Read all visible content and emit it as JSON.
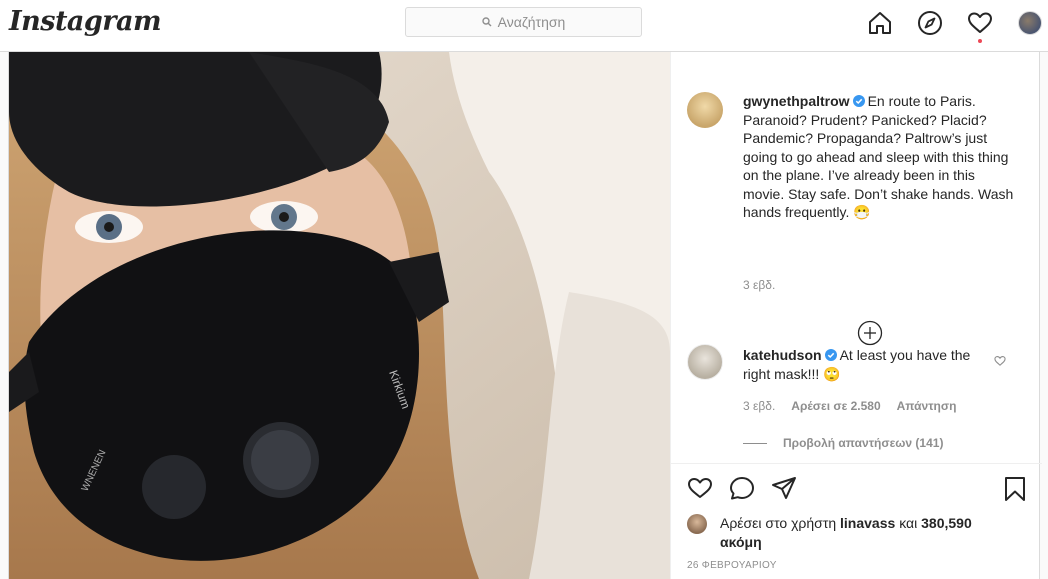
{
  "header": {
    "logo": "Instagram",
    "search_placeholder": "Αναζήτηση"
  },
  "nav": [
    "home-icon",
    "explore-icon",
    "activity-heart-icon",
    "profile-avatar"
  ],
  "post": {
    "author": "gwynethpaltrow",
    "caption": "En route to Paris. Paranoid? Prudent? Panicked? Placid? Pandemic? Propaganda? Paltrow’s just going to go ahead and sleep with this thing on the plane. I’ve already been in this movie. Stay safe. Don’t shake hands. Wash hands frequently. 😷",
    "time": "3 εβδ.",
    "comment": {
      "author": "katehudson",
      "text": "At least you have the right mask!!! 🙄",
      "time": "3 εβδ.",
      "likes": "Αρέσει σε 2.580",
      "reply": "Απάντηση",
      "view_replies": "Προβολή απαντήσεων (141)"
    },
    "likes_prefix": "Αρέσει στο χρήστη",
    "likes_user": "linavass",
    "likes_and": "και",
    "likes_more": "380,590 ακόμη",
    "date": "26 ΦΕΒΡΟΥΑΡΙΟΥ",
    "mask_brand": "WNENEN",
    "mask_logo": "Kirkium"
  },
  "colors": {
    "verified": "#3897f0",
    "notification_dot": "#ed4956"
  }
}
